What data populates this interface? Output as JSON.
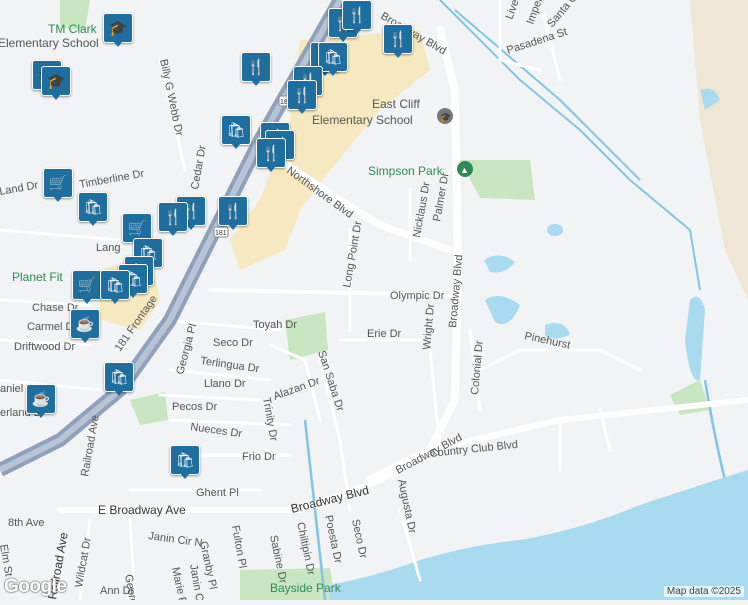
{
  "map": {
    "attribution": "Map data ©2025",
    "logo": "Google",
    "colors": {
      "water": "#a8daf0",
      "park": "#c8e6c0",
      "commercial": "#f6e9bf",
      "road": "#ffffff",
      "highway": "#8fa1bb",
      "pin": "#1e6f9f",
      "park_label": "#2e8b57",
      "background": "#f1f3f4"
    },
    "places": {
      "tm_clark": "TM Clark",
      "elementary_school": "Elementary School",
      "east_cliff": "East Cliff",
      "east_cliff_school": "Elementary School",
      "simpson_park": "Simpson Park",
      "planet_fitness": "Planet Fit",
      "bayside_park": "Bayside Park"
    },
    "streets": {
      "broadway_blvd_top": "Broadway Blvd",
      "billy_g_webb": "Billy G Webb Dr",
      "liverpool": "Liverp",
      "imperial": "Imper",
      "santa_cruz": "Santa C",
      "pasadena": "Pasadena St",
      "northshore": "Northshore Blvd",
      "long_point": "Long Point Dr",
      "nicklaus": "Nicklaus Dr",
      "palmer": "Palmer Dr",
      "broadway_blvd_mid": "Broadway Blvd",
      "olympic": "Olympic Dr",
      "wright": "Wright Dr",
      "erie": "Erie Dr",
      "pinehurst": "Pinehurst",
      "colonial": "Colonial Dr",
      "timberline": "Timberline Dr",
      "cedar": "Cedar Dr",
      "land": "Land Dr",
      "lang": "Lang",
      "chase": "Chase Dr",
      "carmel": "Carmel D",
      "driftwood": "Driftwood Dr",
      "daniel": "aniel",
      "overland": "erland D",
      "frontage": "181 Frontage",
      "toyah": "Toyah Dr",
      "seco_top": "Seco Dr",
      "georgia_top": "Georgia Pl",
      "terlingua": "Terlingua Dr",
      "llano": "Llano Dr",
      "alazan": "Alazan Dr",
      "san_saba": "San Saba Dr",
      "pecos": "Pecos Dr",
      "nueces": "Nueces Dr",
      "trinity": "Trinity Dr",
      "frio": "Frio Dr",
      "railroad_ave_top": "Railroad Ave",
      "country_club": "Country Club Blvd",
      "broadway_blvd_low": "Broadway Blvd",
      "ghent": "Ghent Pl",
      "e_broadway": "E Broadway Ave",
      "broadway_blvd_bottom": "Broadway Blvd",
      "augusta": "Augusta Dr",
      "eighth_ave": "8th Ave",
      "railroad_ave": "Railroad Ave",
      "wildcat": "Wildcat Dr",
      "georgia_low": "Georgia Pl",
      "janin_cir": "Janin Cir N",
      "granby": "Granby Pl",
      "fulton": "Fulton Pl",
      "janin_cir_s": "Janin Cir",
      "sabine": "Sabine Dr",
      "chiltipin": "Chiltipin Dr",
      "poesta": "Poesta Dr",
      "seco_low": "Seco Dr",
      "ann": "Ann Dr",
      "marie": "Marie P",
      "hwy_181": "181",
      "hwy_181_low": "181",
      "elm": "Elm St"
    },
    "pin_icons": {
      "school": "🎓",
      "restaurant": "🍴",
      "shopping": "🛍",
      "cart": "🛒",
      "cafe": "☕"
    }
  }
}
